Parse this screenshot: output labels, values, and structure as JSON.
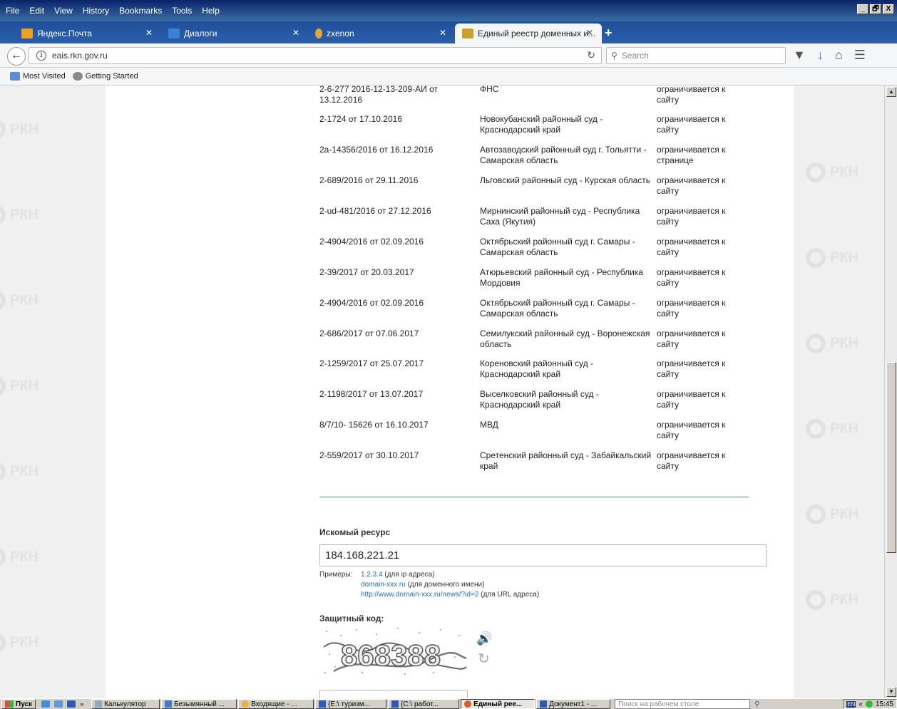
{
  "menubar": {
    "items": [
      "File",
      "Edit",
      "View",
      "History",
      "Bookmarks",
      "Tools",
      "Help"
    ]
  },
  "window_controls": [
    "_",
    "🗗",
    "X"
  ],
  "tabs": [
    {
      "label": "Яндекс.Почта",
      "color": "#f0a020"
    },
    {
      "label": "Диалоги",
      "color": "#3b82d6"
    },
    {
      "label": "zxenon",
      "color": "#e0a830"
    },
    {
      "label": "Единый реестр доменных и...",
      "color": "#c9a030",
      "active": true
    }
  ],
  "navbar": {
    "url": "eais.rkn.gov.ru",
    "search_placeholder": "Search"
  },
  "bookmarks": [
    {
      "label": "Most Visited"
    },
    {
      "label": "Getting Started"
    }
  ],
  "watermark_text": "РКН",
  "table_rows": [
    {
      "doc": "2-6-277 2016-12-13-209-АИ от 13.12.2016",
      "org": "ФНС",
      "scope": "ограничивается к сайту"
    },
    {
      "doc": "2-1724 от 17.10.2016",
      "org": "Новокубанский районный суд - Краснодарский край",
      "scope": "ограничивается к сайту"
    },
    {
      "doc": "2а-14356/2016 от 16.12.2016",
      "org": "Автозаводский районный суд г. Тольятти - Самарская область",
      "scope": "ограничивается к странице"
    },
    {
      "doc": "2-689/2016 от 29.11.2016",
      "org": "Льговский районный суд - Курская область",
      "scope": "ограничивается к сайту"
    },
    {
      "doc": "2-ud-481/2016 от 27.12.2016",
      "org": "Мирнинский районный суд - Республика Саха (Якутия)",
      "scope": "ограничивается к сайту"
    },
    {
      "doc": "2-4904/2016 от 02.09.2016",
      "org": "Октябрьский районный суд г. Самары - Самарская область",
      "scope": "ограничивается к сайту"
    },
    {
      "doc": "2-39/2017 от 20.03.2017",
      "org": "Атюрьевский районный суд - Республика Мордовия",
      "scope": "ограничивается к сайту"
    },
    {
      "doc": "2-4904/2016 от 02.09.2016",
      "org": "Октябрьский районный суд г. Самары - Самарская область",
      "scope": "ограничивается к сайту"
    },
    {
      "doc": "2-686/2017 от 07.06.2017",
      "org": "Семилукский районный суд - Воронежская область",
      "scope": "ограничивается к сайту"
    },
    {
      "doc": "2-1259/2017 от 25.07.2017",
      "org": "Кореновский районный суд - Краснодарский край",
      "scope": "ограничивается к сайту"
    },
    {
      "doc": "2-1198/2017 от 13.07.2017",
      "org": "Выселковский районный суд - Краснодарский край",
      "scope": "ограничивается к сайту"
    },
    {
      "doc": "8/7/10- 15626 от 16.10.2017",
      "org": "МВД",
      "scope": "ограничивается к сайту"
    },
    {
      "doc": "2-559/2017 от 30.10.2017",
      "org": "Сретенский районный суд - Забайкальский край",
      "scope": "ограничивается к сайту"
    }
  ],
  "resource": {
    "label": "Искомый ресурс",
    "value": "184.168.221.21"
  },
  "examples": {
    "label": "Примеры:",
    "items": [
      {
        "link": "1.2.3.4",
        "note": "(для ip адреса)"
      },
      {
        "link": "domain-xxx.ru",
        "note": "(для доменного имени)"
      },
      {
        "link": "http://www.domain-xxx.ru/news/?id=2",
        "note": "(для URL адреса)"
      }
    ]
  },
  "captcha": {
    "label": "Защитный код:",
    "code_image_text": "868388"
  },
  "taskbar": {
    "start": "Пуск",
    "items": [
      {
        "label": "Калькулятор"
      },
      {
        "label": "Безымянный ..."
      },
      {
        "label": "Входящие - ..."
      },
      {
        "label": "{E:\\   туризм..."
      },
      {
        "label": "{C:\\   работ..."
      },
      {
        "label": "Единый рее...",
        "active": true
      },
      {
        "label": "Документ1 - ..."
      }
    ],
    "search_placeholder": "Поиск на рабочем столе",
    "lang": "EN",
    "time": "15:45"
  }
}
